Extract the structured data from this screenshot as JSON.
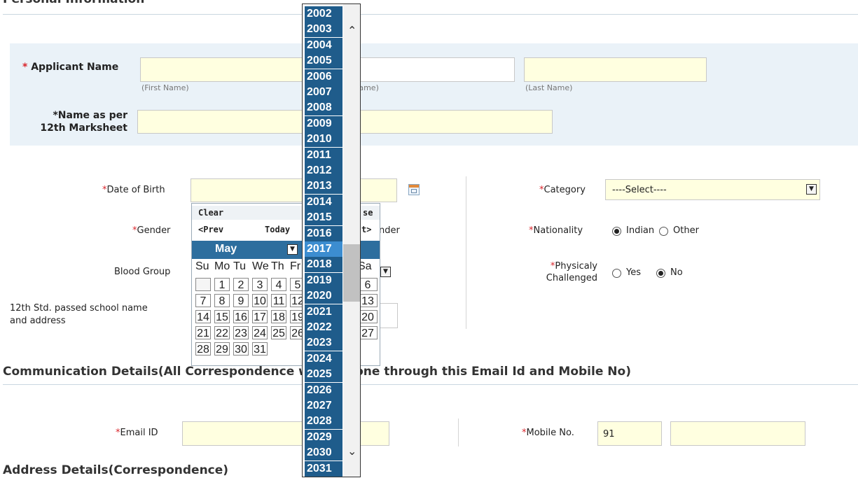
{
  "sections": {
    "personal": "Personal Information",
    "communication": "Communication Details(All Correspondence will be done through this Email Id and Mobile No)",
    "address": "Address Details(Correspondence)"
  },
  "applicant": {
    "req_mark": "*",
    "label": "Applicant Name",
    "hint_first": "(First Name)",
    "hint_middle": "(Middle Name)",
    "hint_last": "(Last Name)"
  },
  "marksheet_name": {
    "label_line1": "*Name as per",
    "label_line2": "12th Marksheet"
  },
  "dob": {
    "label": "Date of Birth"
  },
  "gender": {
    "label": "Gender",
    "trail_text": "nder"
  },
  "blood_group": {
    "label": "Blood Group"
  },
  "school": {
    "label_line1": "12th Std. passed school name",
    "label_line2": "and address"
  },
  "category": {
    "label": "Category",
    "value": "----Select----"
  },
  "nationality": {
    "label": "Nationality",
    "options": [
      "Indian",
      "Other"
    ],
    "selected": "Indian"
  },
  "physically": {
    "label_line1": "*Physicaly",
    "label_line2": "Challenged",
    "options": [
      "Yes",
      "No"
    ],
    "selected": "No"
  },
  "email": {
    "label": "Email ID"
  },
  "mobile": {
    "label": "Mobile No.",
    "code": "91"
  },
  "calendar": {
    "clear": "Clear",
    "close_partial": "se",
    "prev": "<Prev",
    "today": "Today",
    "next_partial": "t>",
    "month": "May",
    "weekdays": [
      "Su",
      "Mo",
      "Tu",
      "We",
      "Th",
      "Fr",
      "Sa"
    ],
    "weeks": [
      [
        "",
        "1",
        "2",
        "3",
        "4",
        "5",
        "6"
      ],
      [
        "7",
        "8",
        "9",
        "10",
        "11",
        "12",
        "13"
      ],
      [
        "14",
        "15",
        "16",
        "17",
        "18",
        "19",
        "20"
      ],
      [
        "21",
        "22",
        "23",
        "24",
        "25",
        "26",
        "27"
      ],
      [
        "28",
        "29",
        "30",
        "31",
        "",
        "",
        ""
      ]
    ]
  },
  "years": [
    "2002",
    "2003",
    "2004",
    "2005",
    "2006",
    "2007",
    "2008",
    "2009",
    "2010",
    "2011",
    "2012",
    "2013",
    "2014",
    "2015",
    "2016",
    "2017",
    "2018",
    "2019",
    "2020",
    "2021",
    "2022",
    "2023",
    "2024",
    "2025",
    "2026",
    "2027",
    "2028",
    "2029",
    "2030",
    "2031"
  ],
  "selected_year": "2017",
  "icons": {
    "calendar": "calendar-icon",
    "dropdown": "chevron-down-icon",
    "scroll_up": "chevron-up-icon",
    "scroll_down": "chevron-down-icon"
  },
  "colors": {
    "required": "#d9262c",
    "input_bg": "#ffffe0",
    "year_bg": "#1f5c8b",
    "year_selected": "#3c8dd0",
    "panel_bg": "#eaf2f8"
  }
}
